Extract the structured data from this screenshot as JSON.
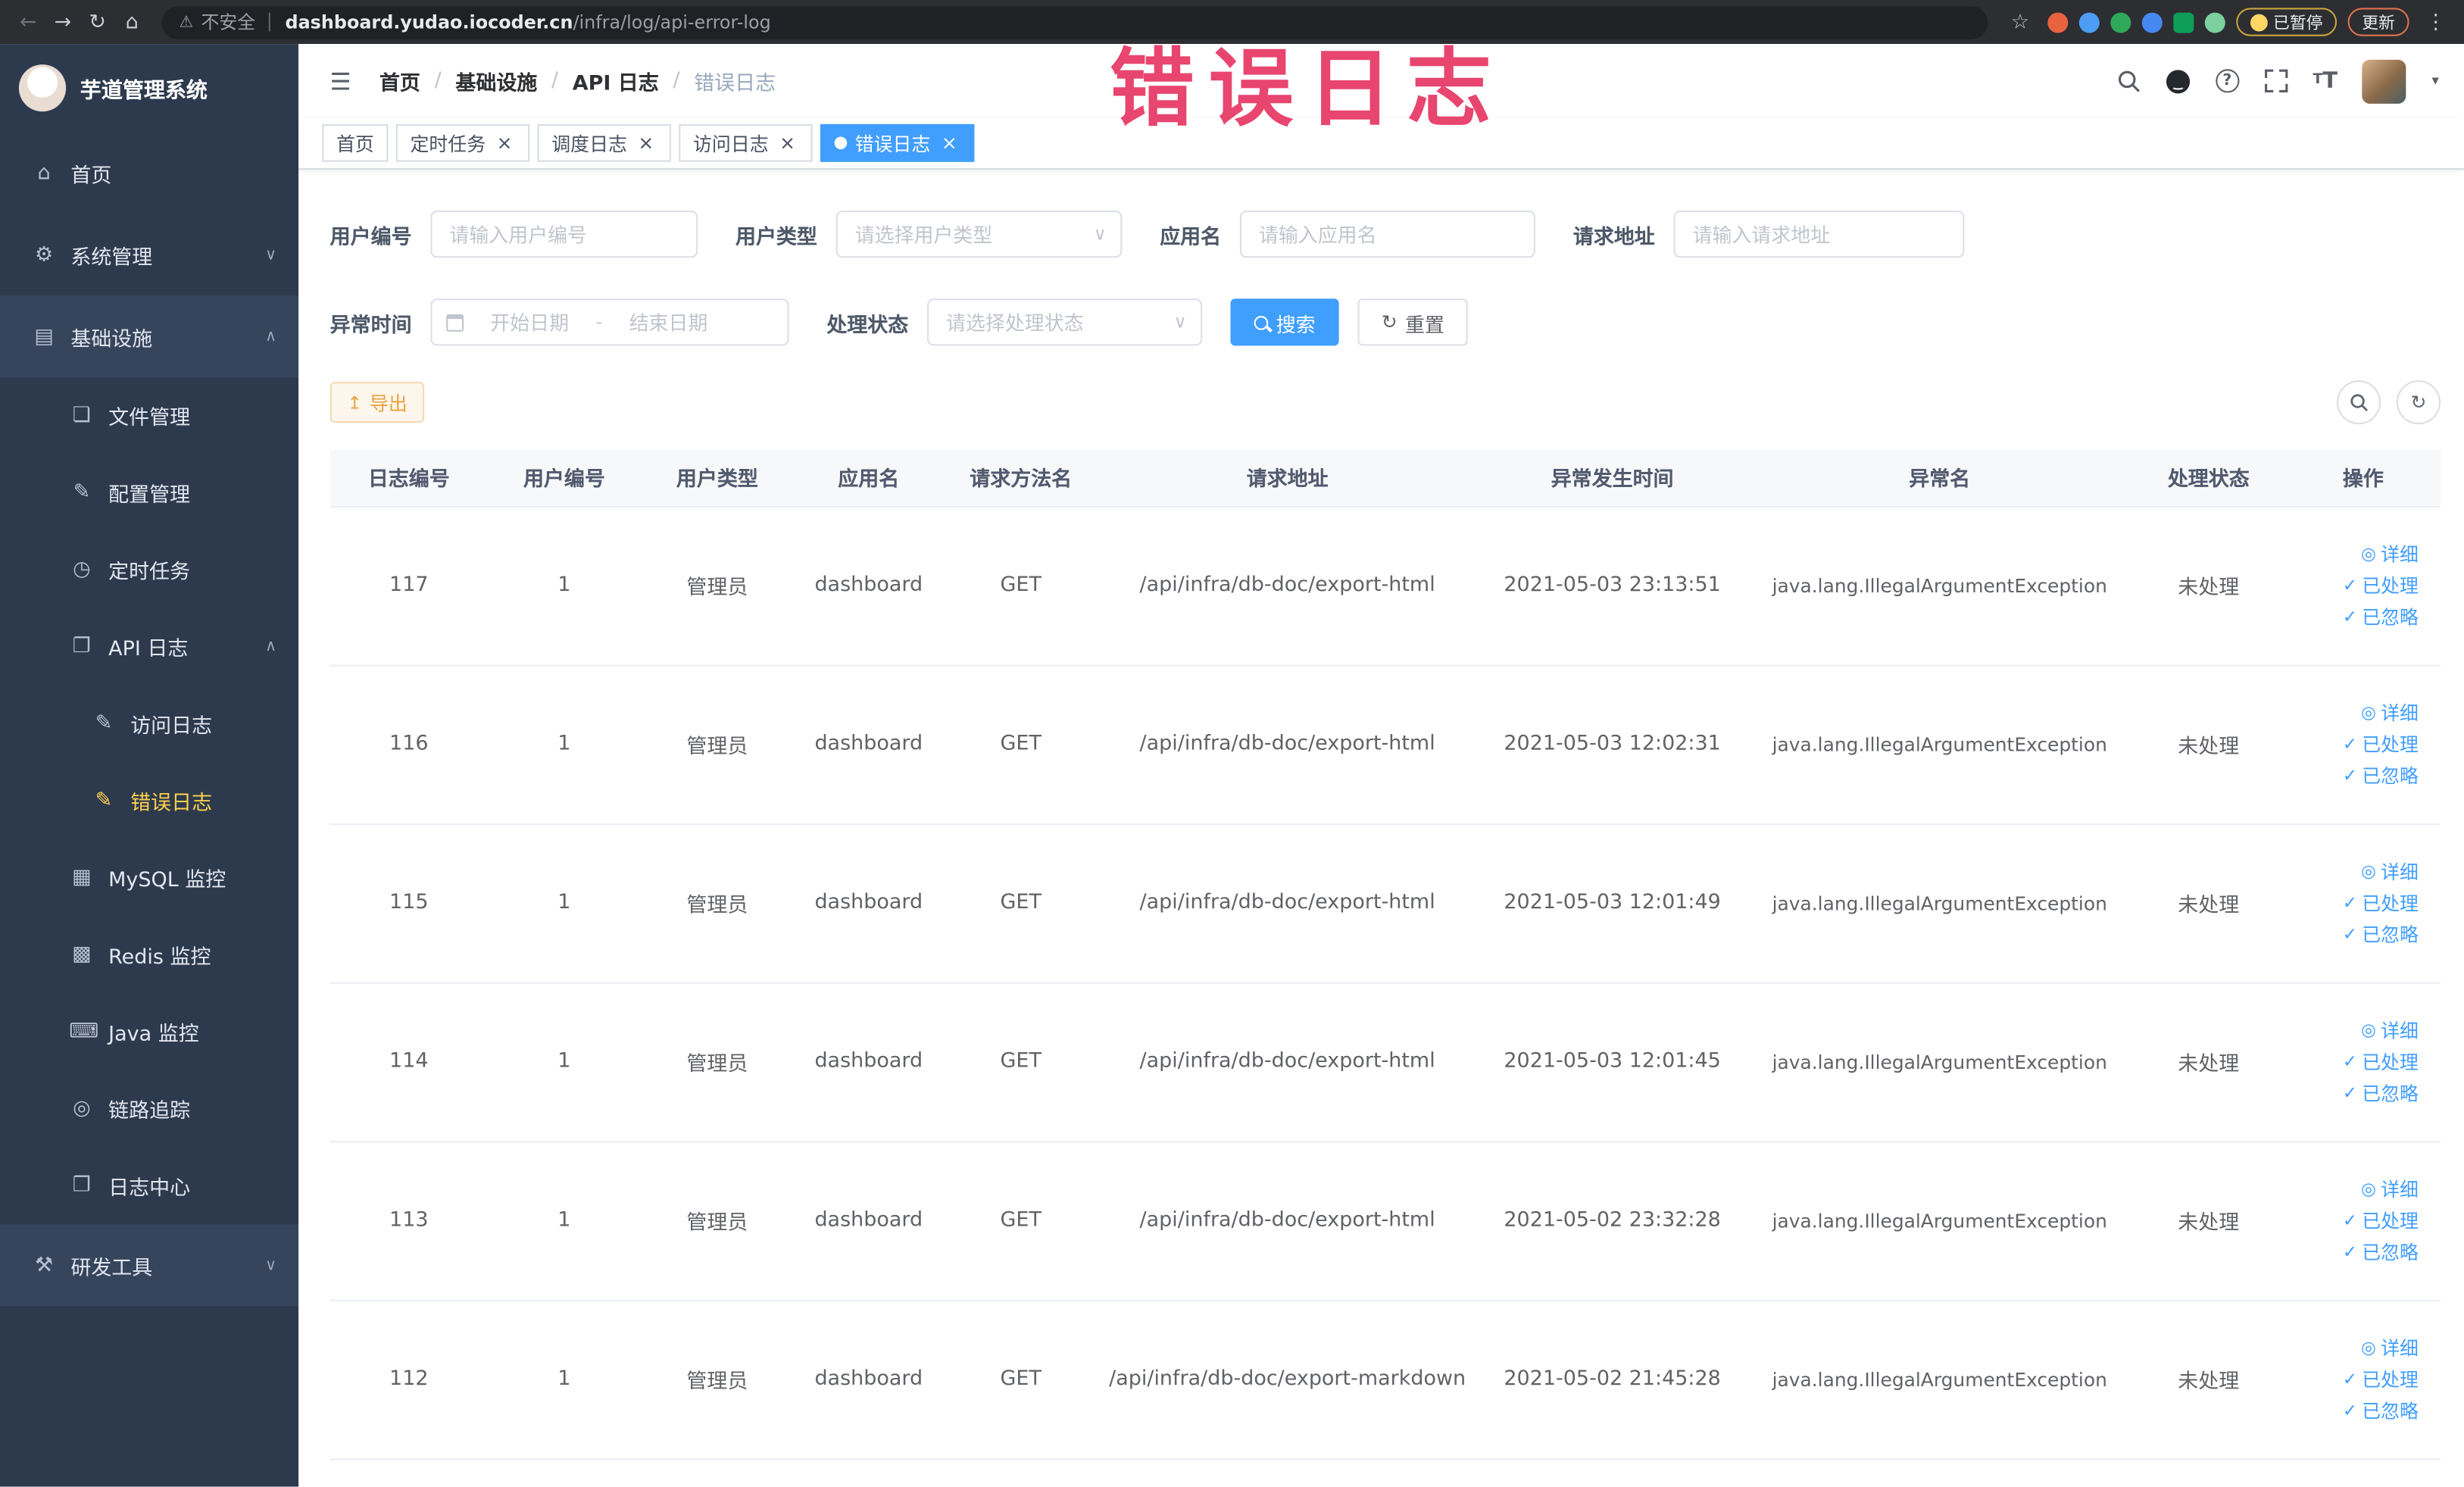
{
  "browser": {
    "security_label": "不安全",
    "url_host": "dashboard.yudao.iocoder.cn",
    "url_path": "/infra/log/api-error-log",
    "paused_badge": "已暂停",
    "update_button": "更新"
  },
  "annotation": {
    "text": "错误日志",
    "color": "#e8456f"
  },
  "sidebar": {
    "title": "芋道管理系统",
    "items": [
      {
        "label": "首页"
      },
      {
        "label": "系统管理"
      },
      {
        "label": "基础设施"
      },
      {
        "label": "文件管理"
      },
      {
        "label": "配置管理"
      },
      {
        "label": "定时任务"
      },
      {
        "label": "API 日志"
      },
      {
        "label": "访问日志"
      },
      {
        "label": "错误日志"
      },
      {
        "label": "MySQL 监控"
      },
      {
        "label": "Redis 监控"
      },
      {
        "label": "Java 监控"
      },
      {
        "label": "链路追踪"
      },
      {
        "label": "日志中心"
      },
      {
        "label": "研发工具"
      }
    ]
  },
  "header": {
    "breadcrumb": [
      "首页",
      "基础设施",
      "API 日志",
      "错误日志"
    ],
    "separator": "/"
  },
  "tabs": [
    {
      "label": "首页"
    },
    {
      "label": "定时任务"
    },
    {
      "label": "调度日志"
    },
    {
      "label": "访问日志"
    },
    {
      "label": "错误日志"
    }
  ],
  "filters": {
    "user_id": {
      "label": "用户编号",
      "placeholder": "请输入用户编号"
    },
    "user_type": {
      "label": "用户类型",
      "placeholder": "请选择用户类型"
    },
    "app_name": {
      "label": "应用名",
      "placeholder": "请输入应用名"
    },
    "request_url": {
      "label": "请求地址",
      "placeholder": "请输入请求地址"
    },
    "exception_time": {
      "label": "异常时间",
      "start_placeholder": "开始日期",
      "end_placeholder": "结束日期",
      "separator": "-"
    },
    "process_status": {
      "label": "处理状态",
      "placeholder": "请选择处理状态"
    },
    "search_button": "搜索",
    "reset_button": "重置"
  },
  "toolbar": {
    "export_button": "导出"
  },
  "table": {
    "columns": [
      "日志编号",
      "用户编号",
      "用户类型",
      "应用名",
      "请求方法名",
      "请求地址",
      "异常发生时间",
      "异常名",
      "处理状态",
      "操作"
    ],
    "actions": [
      "详细",
      "已处理",
      "已忽略"
    ],
    "rows": [
      {
        "log_id": "117",
        "user_id": "1",
        "user_type": "管理员",
        "app_name": "dashboard",
        "method": "GET",
        "url": "/api/infra/db-doc/export-html",
        "time": "2021-05-03 23:13:51",
        "exception": "java.lang.IllegalArgumentException",
        "status": "未处理"
      },
      {
        "log_id": "116",
        "user_id": "1",
        "user_type": "管理员",
        "app_name": "dashboard",
        "method": "GET",
        "url": "/api/infra/db-doc/export-html",
        "time": "2021-05-03 12:02:31",
        "exception": "java.lang.IllegalArgumentException",
        "status": "未处理"
      },
      {
        "log_id": "115",
        "user_id": "1",
        "user_type": "管理员",
        "app_name": "dashboard",
        "method": "GET",
        "url": "/api/infra/db-doc/export-html",
        "time": "2021-05-03 12:01:49",
        "exception": "java.lang.IllegalArgumentException",
        "status": "未处理"
      },
      {
        "log_id": "114",
        "user_id": "1",
        "user_type": "管理员",
        "app_name": "dashboard",
        "method": "GET",
        "url": "/api/infra/db-doc/export-html",
        "time": "2021-05-03 12:01:45",
        "exception": "java.lang.IllegalArgumentException",
        "status": "未处理"
      },
      {
        "log_id": "113",
        "user_id": "1",
        "user_type": "管理员",
        "app_name": "dashboard",
        "method": "GET",
        "url": "/api/infra/db-doc/export-html",
        "time": "2021-05-02 23:32:28",
        "exception": "java.lang.IllegalArgumentException",
        "status": "未处理"
      },
      {
        "log_id": "112",
        "user_id": "1",
        "user_type": "管理员",
        "app_name": "dashboard",
        "method": "GET",
        "url": "/api/infra/db-doc/export-markdown",
        "time": "2021-05-02 21:45:28",
        "exception": "java.lang.IllegalArgumentException",
        "status": "未处理"
      }
    ]
  },
  "icons": {
    "back": "←",
    "forward": "→",
    "refresh": "↻",
    "home": "⌂",
    "warning": "⚠",
    "star": "☆",
    "menu": "⋮",
    "hamburger": "☰",
    "close": "×",
    "chev_down": "∨",
    "chev_up": "∧",
    "caret_down": "▾",
    "question": "?",
    "font_small": "T",
    "font_large": "T",
    "sb_home": "⌂",
    "sb_system": "⚙",
    "sb_infra": "▤",
    "sb_file": "❏",
    "sb_config": "✎",
    "sb_job": "◷",
    "sb_api": "❐",
    "sb_access": "✎",
    "sb_error": "✎",
    "sb_mysql": "▦",
    "sb_redis": "▩",
    "sb_java": "⌨",
    "sb_trace": "◎",
    "sb_logcenter": "❒",
    "sb_devtools": "⚒",
    "export": "↥",
    "detail": "◎",
    "check": "✓"
  },
  "theme": {
    "primary": "#409eff",
    "sidebar_bg": "#2d3a4e",
    "sidebar_active_text": "#ffd04b",
    "warning_button_text": "#e6a23c",
    "annotation_color": "#e8456f"
  }
}
